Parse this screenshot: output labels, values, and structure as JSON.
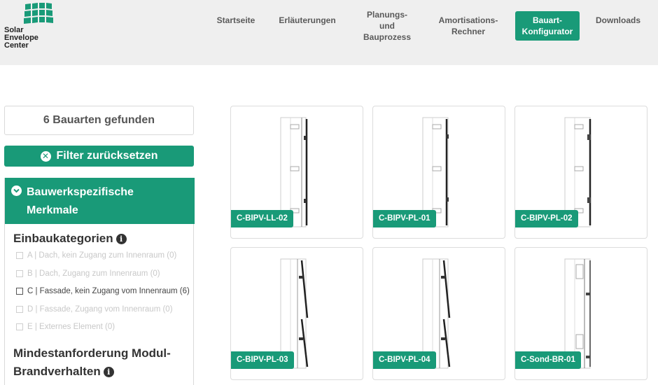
{
  "logo": {
    "lines": [
      "Solar",
      "Envelope",
      "Center"
    ]
  },
  "nav": {
    "items": [
      {
        "l1": "Startseite",
        "l2": ""
      },
      {
        "l1": "Erläuterungen",
        "l2": ""
      },
      {
        "l1": "Planungs- und",
        "l2": "Bauprozess"
      },
      {
        "l1": "Amortisations-",
        "l2": "Rechner"
      },
      {
        "l1": "Bauart-",
        "l2": "Konfigurator"
      },
      {
        "l1": "Downloads",
        "l2": ""
      }
    ],
    "active_index": 4
  },
  "filter": {
    "result_count": "6 Bauarten gefunden",
    "reset_label": "Filter zurücksetzen",
    "panel_title_line1": "Bauwerkspezifische",
    "panel_title_line2": "Merkmale",
    "section1_title": "Einbaukategorien",
    "categories": [
      {
        "label": "A | Dach, kein Zugang zum Innenraum (0)",
        "enabled": false
      },
      {
        "label": "B | Dach, Zugang zum Innenraum (0)",
        "enabled": false
      },
      {
        "label": "C | Fassade, kein Zugang vom Innenraum (6)",
        "enabled": true
      },
      {
        "label": "D | Fassade, Zugang vom Innenraum (0)",
        "enabled": false
      },
      {
        "label": "E | Externes Element (0)",
        "enabled": false
      }
    ],
    "section2_title_line1": "Mindestanforderung Modul-",
    "section2_title_line2": "Brandverhalten"
  },
  "results": [
    {
      "label": "C-BIPV-LL-02"
    },
    {
      "label": "C-BIPV-PL-01"
    },
    {
      "label": "C-BIPV-PL-02"
    },
    {
      "label": "C-BIPV-PL-03"
    },
    {
      "label": "C-BIPV-PL-04"
    },
    {
      "label": "C-Sond-BR-01"
    }
  ],
  "colors": {
    "accent": "#199a78",
    "header_bg": "#efefef"
  }
}
